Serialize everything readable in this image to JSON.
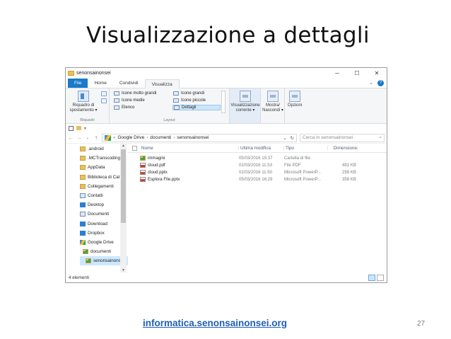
{
  "slide": {
    "title": "Visualizzazione a dettagli",
    "footer_link": "informatica.senonsainonsei.org",
    "page_number": "27"
  },
  "window": {
    "title": "senonsainonsei",
    "controls": [
      "─",
      "☐",
      "✕"
    ],
    "tabs": [
      {
        "label": "File"
      },
      {
        "label": "Home"
      },
      {
        "label": "Condividi"
      },
      {
        "label": "Visualizza"
      }
    ],
    "ribbon": {
      "pane_button": [
        "Riquadro di",
        "spostamento ▾"
      ],
      "pane_group_label": "Riquadri",
      "layout_options": [
        "Icone molto grandi",
        "Icone grandi",
        "Icone medie",
        "Icone piccole",
        "Elenco",
        "Dettagli"
      ],
      "layout_selected": "Dettagli",
      "layout_group_label": "Layout",
      "view_buttons": [
        [
          "Visualizzazione",
          "corrente ▾"
        ],
        [
          "Mostra/",
          "Nascondi ▾"
        ],
        [
          "Opzioni",
          ""
        ]
      ]
    },
    "address": {
      "prefix": "«",
      "path": [
        "Google Drive",
        "documenti",
        "senonsainonsei"
      ],
      "search_placeholder": "Cerca in senonsainonsei",
      "search_icon": "search-icon"
    },
    "nav_pane": [
      {
        "label": ".android",
        "icon": "folder"
      },
      {
        "label": ".MCTranscoding",
        "icon": "folder"
      },
      {
        "label": "AppData",
        "icon": "folder"
      },
      {
        "label": "Biblioteca di Cal",
        "icon": "folder"
      },
      {
        "label": "Collegamenti",
        "icon": "folder"
      },
      {
        "label": "Contatti",
        "icon": "doc"
      },
      {
        "label": "Desktop",
        "icon": "blue"
      },
      {
        "label": "Documenti",
        "icon": "doc"
      },
      {
        "label": "Download",
        "icon": "blue"
      },
      {
        "label": "Dropbox",
        "icon": "blue"
      },
      {
        "label": "Google Drive",
        "icon": "gdrive"
      },
      {
        "label": "documenti",
        "icon": "gfolder"
      },
      {
        "label": "senonsainonsei",
        "icon": "gfolder"
      }
    ],
    "columns": {
      "name": "Nome",
      "date": "Ultima modifica",
      "type": "Tipo",
      "size": "Dimensione"
    },
    "files": [
      {
        "name": "immagini",
        "date": "05/03/2016 15:37",
        "type": "Cartella di file",
        "size": "",
        "icon": "gfolder"
      },
      {
        "name": "cloud.pdf",
        "date": "02/03/2016 11:53",
        "type": "File PDF",
        "size": "491 KB",
        "icon": "pdf"
      },
      {
        "name": "cloud.pptx",
        "date": "02/03/2016 11:50",
        "type": "Microsoft PowerP...",
        "size": "299 KB",
        "icon": "ppt"
      },
      {
        "name": "Esplora File.pptx",
        "date": "05/03/2016 16:29",
        "type": "Microsoft PowerP...",
        "size": "358 KB",
        "icon": "ppt"
      }
    ],
    "status": "4 elementi"
  }
}
